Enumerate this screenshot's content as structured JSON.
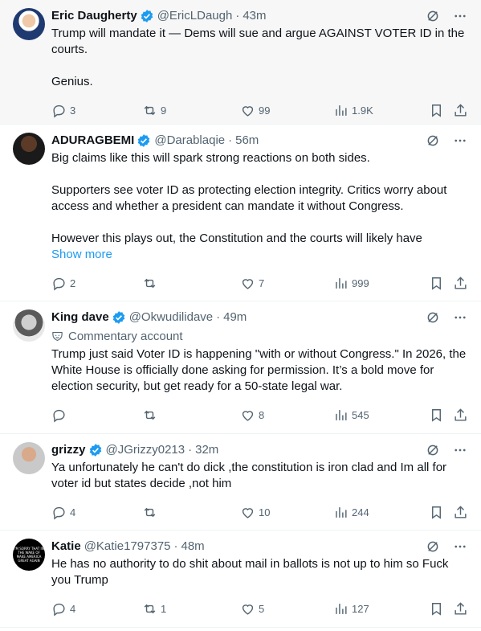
{
  "colors": {
    "verified": "#1d9bf0",
    "link": "#1d9bf0",
    "muted": "#536471",
    "text": "#0f1419",
    "highlight_bg": "#f7f7f7"
  },
  "tweets": [
    {
      "name": "Eric Daugherty",
      "verified": true,
      "handle": "@EricLDaugh",
      "dot": "·",
      "time": "43m",
      "body": "Trump will mandate it — Dems will sue and argue AGAINST VOTER ID in the courts.\n\nGenius.",
      "stats": {
        "replies": "3",
        "reposts": "9",
        "likes": "99",
        "views": "1.9K"
      }
    },
    {
      "name": "ADURAGBEMI",
      "verified": true,
      "handle": "@Darablaqie",
      "dot": "·",
      "time": "56m",
      "body": "Big claims like this will spark strong reactions on both sides.\n\nSupporters see voter ID as protecting election integrity. Critics worry about access and whether a president can mandate it without Congress.\n\nHowever this plays out, the Constitution and the courts will likely have",
      "show_more": "Show more",
      "stats": {
        "replies": "2",
        "reposts": "",
        "likes": "7",
        "views": "999"
      }
    },
    {
      "name": "King dave",
      "verified": true,
      "handle": "@Okwudilidave",
      "dot": "·",
      "time": "49m",
      "subline": "Commentary account",
      "body": "Trump just said Voter ID is happening \"with or without Congress.\" In 2026, the White House is officially done asking for permission. It’s a bold move for election security, but get ready for a 50-state legal war.",
      "stats": {
        "replies": "",
        "reposts": "",
        "likes": "8",
        "views": "545"
      }
    },
    {
      "name": "grizzy",
      "verified": true,
      "handle": "@JGrizzy0213",
      "dot": "·",
      "time": "32m",
      "body": "Ya unfortunately he can't do dick ,the constitution is iron clad and Im all for voter id but states decide ,not him",
      "stats": {
        "replies": "4",
        "reposts": "",
        "likes": "10",
        "views": "244"
      }
    },
    {
      "name": "Katie",
      "verified": false,
      "handle": "@Katie1797375",
      "dot": "·",
      "time": "48m",
      "avatar_text": "I'M SORRY THAT IN THE WAKE OF MAKE AMERICA GREAT AGAIN",
      "body": "He has no authority to do shit about mail in ballots is not up to him so Fuck you Trump",
      "stats": {
        "replies": "4",
        "reposts": "1",
        "likes": "5",
        "views": "127"
      }
    }
  ],
  "icons": [
    "verified-badge-icon",
    "grok-icon",
    "more-icon",
    "reply-icon",
    "repost-icon",
    "like-icon",
    "views-icon",
    "bookmark-icon",
    "share-icon",
    "commentary-icon"
  ]
}
